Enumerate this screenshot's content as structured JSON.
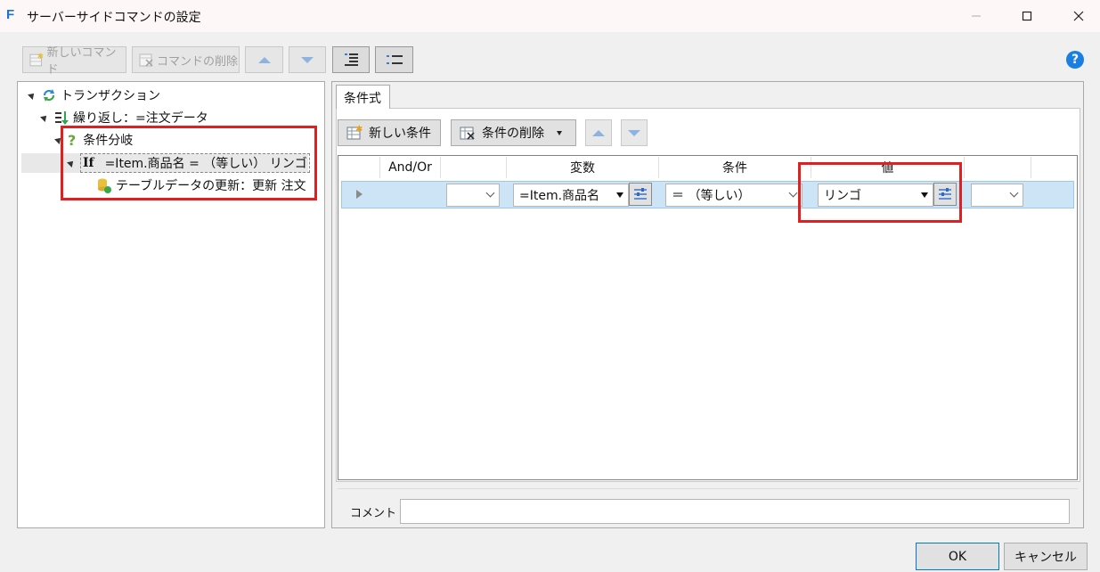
{
  "window": {
    "title": "サーバーサイドコマンドの設定"
  },
  "toolbar": {
    "new_command": "新しいコマンド",
    "delete_command": "コマンドの削除"
  },
  "tree": {
    "transaction": "トランザクション",
    "loop": "繰り返し：=注文データ",
    "branch": "条件分岐",
    "if_keyword": "If",
    "if_condition": "=Item.商品名 = （等しい） リンゴ",
    "update": "テーブルデータの更新：更新 注文"
  },
  "tab": {
    "label": "条件式"
  },
  "condition_toolbar": {
    "new_condition": "新しい条件",
    "delete_condition": "条件の削除"
  },
  "grid": {
    "headers": [
      "And/Or",
      "変数",
      "条件",
      "値"
    ],
    "row": {
      "and_or": "",
      "variable": "=Item.商品名",
      "operator": "＝ （等しい）",
      "value": "リンゴ",
      "extra": ""
    }
  },
  "comment": {
    "label": "コメント",
    "value": ""
  },
  "buttons": {
    "ok": "OK",
    "cancel": "キャンセル"
  },
  "colors": {
    "highlight": "#e02020",
    "selection": "#cde4f7",
    "accent": "#1a7fe0"
  },
  "icons": [
    "app-icon",
    "minimize-icon",
    "maximize-icon",
    "close-icon",
    "help-icon",
    "transaction-icon",
    "loop-icon",
    "question-icon",
    "update-icon"
  ]
}
